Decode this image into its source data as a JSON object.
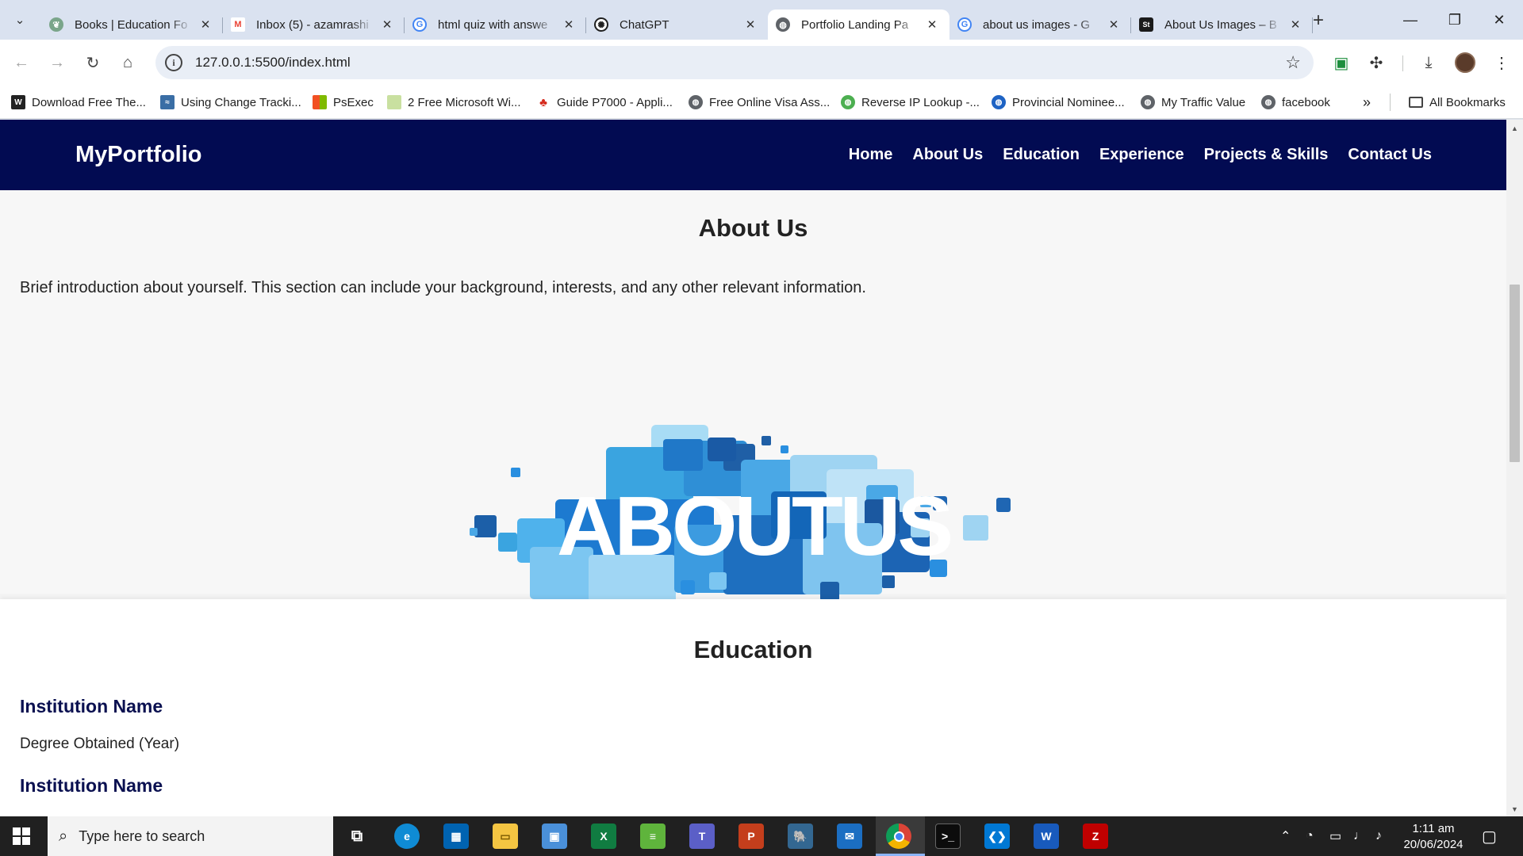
{
  "browser": {
    "tabs": [
      {
        "title": "Books | Education Fo",
        "favicon": "leaf-icon",
        "fav_color": "#7aa58a",
        "active": false
      },
      {
        "title": "Inbox (5) - azamrashi",
        "favicon": "gmail-icon",
        "fav_color": "#ea4335",
        "active": false
      },
      {
        "title": "html quiz with answe",
        "favicon": "google-icon",
        "fav_color": "#4285f4",
        "active": false
      },
      {
        "title": "ChatGPT",
        "favicon": "chatgpt-icon",
        "fav_color": "#1f1f1f",
        "active": false
      },
      {
        "title": "Portfolio Landing Pa",
        "favicon": "globe-icon",
        "fav_color": "#5f6368",
        "active": true
      },
      {
        "title": "about us images - G",
        "favicon": "google-icon",
        "fav_color": "#4285f4",
        "active": false
      },
      {
        "title": "About Us Images – B",
        "favicon": "shutterstock-icon",
        "fav_color": "#1a1a1a",
        "active": false
      }
    ],
    "url": "127.0.0.1:5500/index.html",
    "bookmarks": [
      {
        "label": "Download Free The...",
        "icon": "wl-icon",
        "color": "#222222"
      },
      {
        "label": "Using Change Tracki...",
        "icon": "doc-icon",
        "color": "#3a6ea5"
      },
      {
        "label": "PsExec",
        "icon": "windows-icon",
        "color": "#f25022"
      },
      {
        "label": "2 Free Microsoft Wi...",
        "icon": "page-icon",
        "color": "#c9e0a0"
      },
      {
        "label": "Guide P7000 - Appli...",
        "icon": "maple-leaf-icon",
        "color": "#d52b1e"
      },
      {
        "label": "Free Online Visa Ass...",
        "icon": "globe-icon",
        "color": "#5f6368"
      },
      {
        "label": "Reverse IP Lookup -...",
        "icon": "globe-green-icon",
        "color": "#4caf50"
      },
      {
        "label": "Provincial Nominee...",
        "icon": "globe-blue-icon",
        "color": "#1e63c4"
      },
      {
        "label": "My Traffic Value",
        "icon": "globe-icon",
        "color": "#5f6368"
      },
      {
        "label": "facebook",
        "icon": "globe-icon",
        "color": "#5f6368"
      }
    ],
    "all_bookmarks": "All Bookmarks"
  },
  "site": {
    "brand": "MyPortfolio",
    "nav": [
      "Home",
      "About Us",
      "Education",
      "Experience",
      "Projects & Skills",
      "Contact Us"
    ],
    "about": {
      "title": "About Us",
      "text": "Brief introduction about yourself. This section can include your background, interests, and any other relevant information.",
      "image_text": "ABOUTUS"
    },
    "education": {
      "title": "Education",
      "entries": [
        {
          "institution": "Institution Name",
          "degree": "Degree Obtained (Year)"
        },
        {
          "institution": "Institution Name",
          "degree": ""
        }
      ]
    }
  },
  "taskbar": {
    "search_placeholder": "Type here to search",
    "time": "1:11 am",
    "date": "20/06/2024",
    "apps": [
      {
        "name": "task-view-icon",
        "color": "#202020"
      },
      {
        "name": "edge-icon",
        "color": "#0f8bd4"
      },
      {
        "name": "store-icon",
        "color": "#0063b1"
      },
      {
        "name": "file-explorer-icon",
        "color": "#f4c542"
      },
      {
        "name": "remote-desktop-icon",
        "color": "#4a90d9"
      },
      {
        "name": "excel-icon",
        "color": "#107c41"
      },
      {
        "name": "stack-icon",
        "color": "#5fb43c"
      },
      {
        "name": "teams-icon",
        "color": "#5b5fc7"
      },
      {
        "name": "powerpoint-icon",
        "color": "#c43e1c"
      },
      {
        "name": "pgadmin-icon",
        "color": "#336791"
      },
      {
        "name": "mail-icon",
        "color": "#1b6ec2"
      },
      {
        "name": "chrome-icon",
        "color": "#db4437"
      },
      {
        "name": "terminal-icon",
        "color": "#0c0c0c"
      },
      {
        "name": "vscode-icon",
        "color": "#0078d4"
      },
      {
        "name": "word-icon",
        "color": "#185abc"
      },
      {
        "name": "filezilla-icon",
        "color": "#bf0000"
      }
    ]
  }
}
